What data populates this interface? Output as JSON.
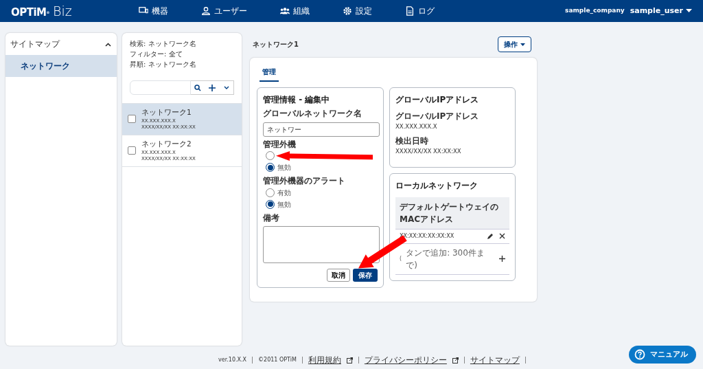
{
  "header": {
    "logo": "OPTiM$^{®}$",
    "product": "Biz",
    "nav": [
      {
        "label": "機器"
      },
      {
        "label": "ユーザー"
      },
      {
        "label": "組織"
      },
      {
        "label": "設定"
      },
      {
        "label": "ログ"
      }
    ],
    "company": "sample_company",
    "user": "sample_user"
  },
  "sidebar": {
    "title": "サイトマップ",
    "expanded": true,
    "items": [
      {
        "label": "ネットワーク",
        "selected": true
      }
    ]
  },
  "list_panel": {
    "info": [
      "検索: ネットワーク名",
      "フィルター: 全て",
      "昇順: ネットワーク名"
    ],
    "items": [
      {
        "name": "ネットワーク1",
        "ip": "XX.XXX.XXX.X",
        "date": "XXXX/XX/XX XX:XX:XX",
        "selected": true,
        "checked": false
      },
      {
        "name": "ネットワーク2",
        "ip": "XX.XXX.XXX.X",
        "date": "XXXX/XX/XX XX:XX:XX",
        "selected": false,
        "checked": false
      }
    ]
  },
  "main": {
    "title": "ネットワーク1",
    "action_button": "操作",
    "tabs": [
      {
        "label": "管理",
        "selected": true
      }
    ],
    "edit_card": {
      "title": "管理情報 - 編集中",
      "name_label": "グローバルネットワーク名",
      "name_value": "ネットワー",
      "radio_groups": [
        {
          "label": "管理外機",
          "options": [
            {
              "selected": false
            },
            {
              "label": "無効",
              "selected": true
            }
          ]
        },
        {
          "label": "管理外機器のアラート",
          "options": [
            {
              "label": "有効",
              "selected": false
            },
            {
              "label": "無効",
              "selected": true
            }
          ]
        }
      ],
      "memo_label": "備考",
      "cancel": "取消",
      "save": "保存"
    },
    "ip_card": {
      "title": "グローバルIPアドレス",
      "rows": [
        {
          "label": "グローバルIPアドレス",
          "value": "XX.XXX.XXX.X"
        },
        {
          "label": "検出日時",
          "value": "XXXX/XX/XX XX:XX:XX"
        }
      ]
    },
    "local_card": {
      "title": "ローカルネットワーク",
      "header": [
        "デフォルトゲートウェイの",
        "MACアドレス"
      ],
      "rows": [
        "XX:XX:XX:XX:XX:XX"
      ],
      "add_prefix": "(",
      "add_hint": "タンで追加: 300件まで)"
    }
  },
  "footer": [
    {
      "label": "ver.10.X.X",
      "kind": "text"
    },
    {
      "label": "©2011 OPTiM",
      "kind": "text"
    },
    {
      "label": "利用規約",
      "kind": "external"
    },
    {
      "label": "プライバシーポリシー",
      "kind": "external"
    },
    {
      "label": "サイトマップ",
      "kind": "link"
    }
  ],
  "manual_button": "マニュアル"
}
